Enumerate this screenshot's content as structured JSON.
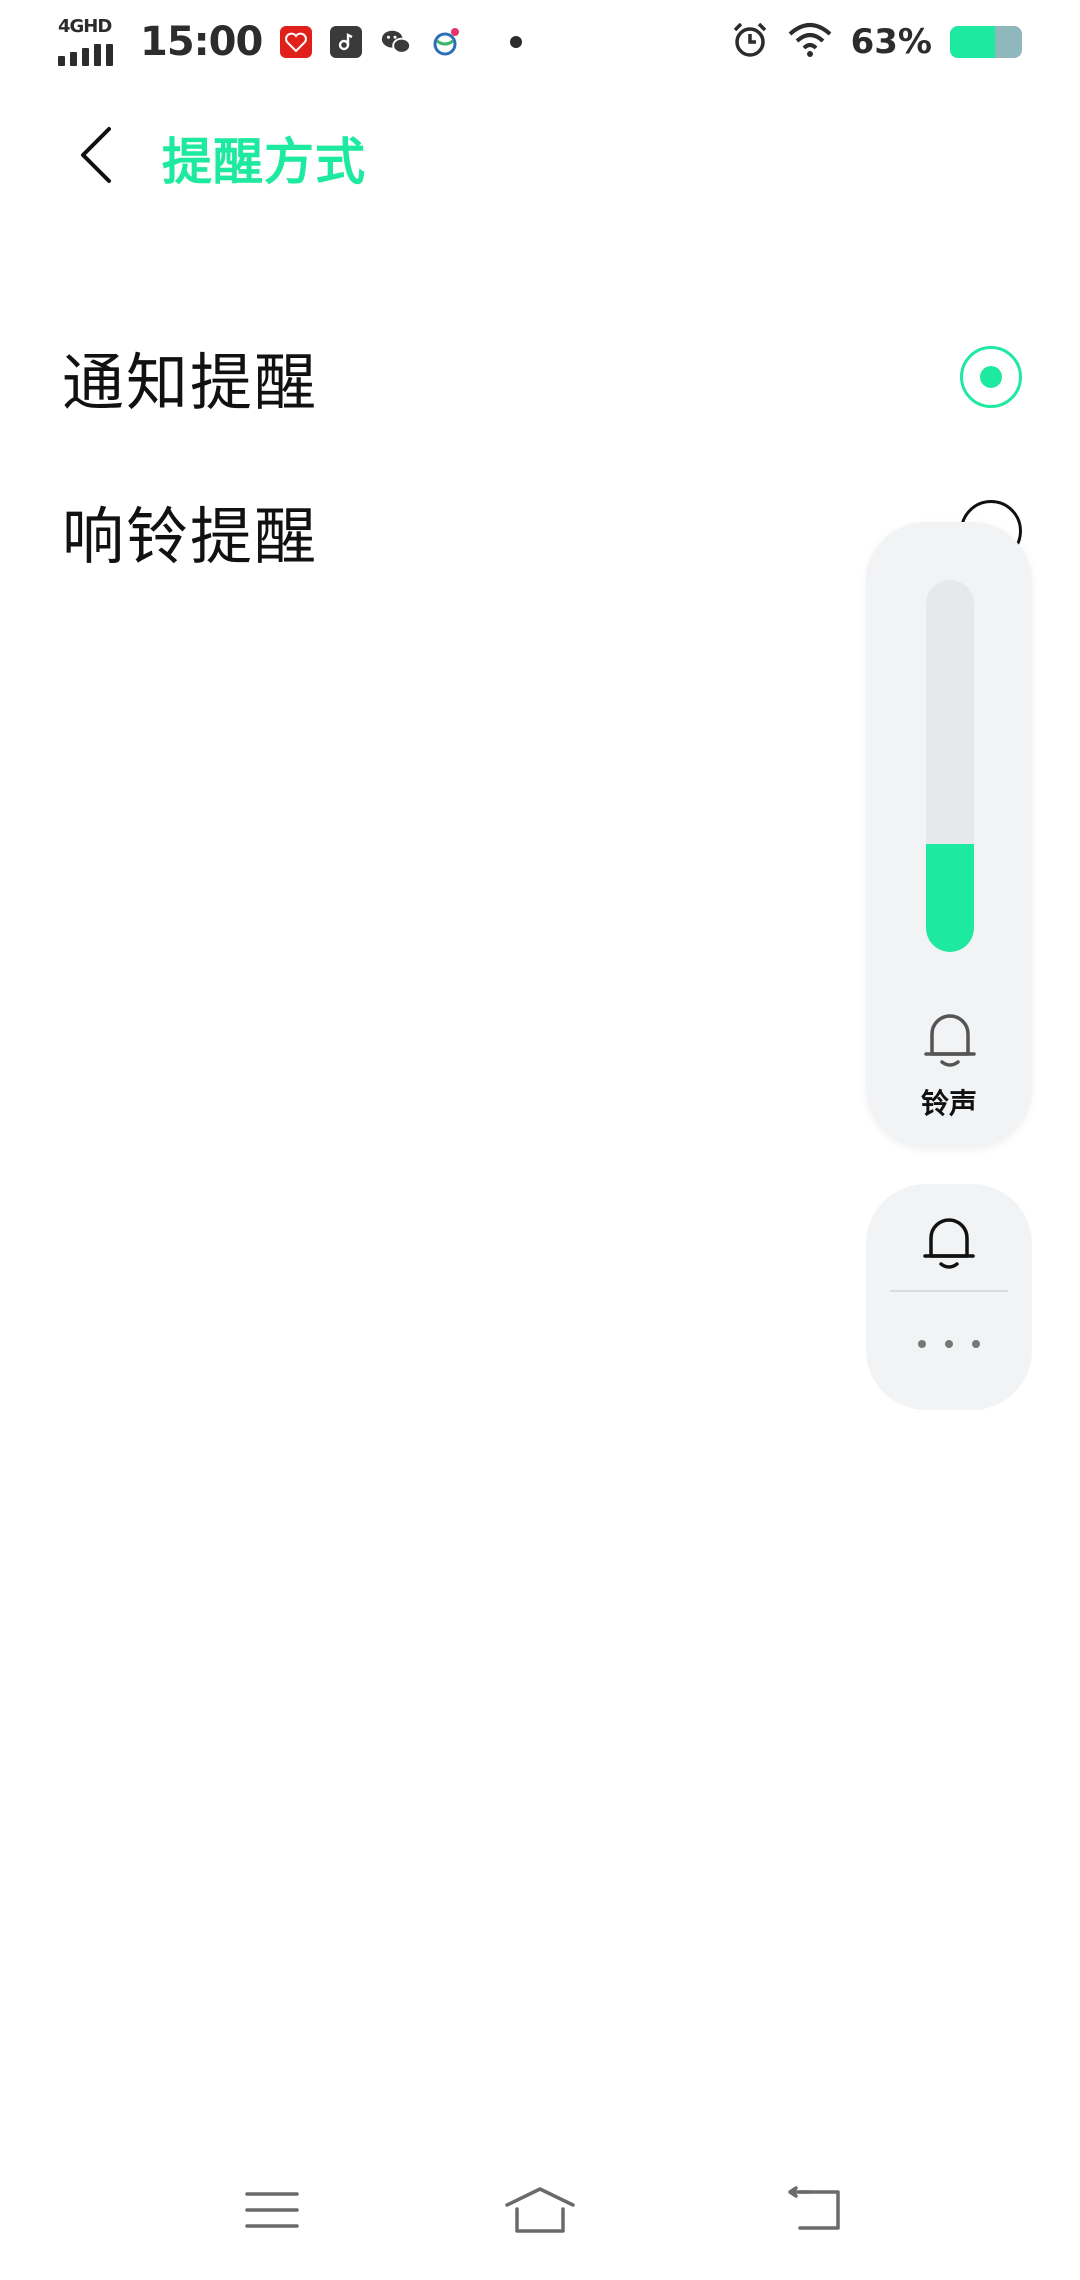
{
  "status_bar": {
    "network": "4GHD",
    "time": "15:00",
    "battery_pct": "63%",
    "battery_level": 0.63,
    "icons": [
      "signal-icon",
      "app-red-icon",
      "music-app-icon",
      "wechat-icon",
      "browser-app-icon",
      "more-notifications-dot",
      "alarm-icon",
      "wifi-icon",
      "battery-icon"
    ]
  },
  "header": {
    "title": "提醒方式",
    "back_icon": "chevron-left-icon"
  },
  "options": [
    {
      "label": "通知提醒",
      "selected": true
    },
    {
      "label": "响铃提醒",
      "selected": false
    }
  ],
  "volume_panel": {
    "label": "铃声",
    "level": 0.29,
    "icon": "bell-icon"
  },
  "mode_panel": {
    "icon": "bell-icon",
    "more_icon": "more-dots-icon"
  },
  "nav_bar": {
    "icons": [
      "menu-icon",
      "home-icon",
      "back-icon"
    ]
  },
  "colors": {
    "accent": "#1de9a0",
    "panel_bg": "#f1f3f5",
    "track_bg": "#e6e8ea"
  }
}
